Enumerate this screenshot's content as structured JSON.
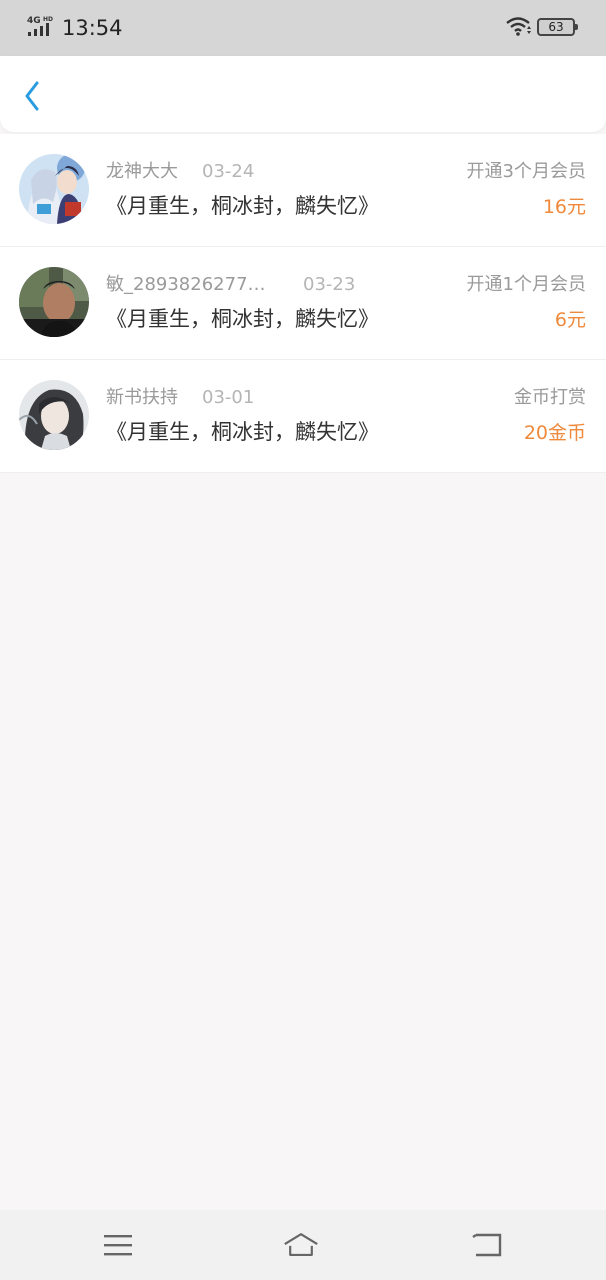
{
  "status_bar": {
    "network": "4G HD",
    "time": "13:54",
    "battery": "63"
  },
  "header": {
    "back_icon": "chevron-left-icon"
  },
  "records": [
    {
      "name": "龙神大大",
      "date": "03-24",
      "book": "《月重生，桐冰封，麟失忆》",
      "type": "开通3个月会员",
      "amount": "16元"
    },
    {
      "name": "敏_2893826277…",
      "date": "03-23",
      "book": "《月重生，桐冰封，麟失忆》",
      "type": "开通1个月会员",
      "amount": "6元"
    },
    {
      "name": "新书扶持",
      "date": "03-01",
      "book": "《月重生，桐冰封，麟失忆》",
      "type": "金币打赏",
      "amount": "20金币"
    }
  ],
  "nav": {
    "menu_icon": "menu-icon",
    "home_icon": "home-icon",
    "back_icon": "back-icon"
  },
  "colors": {
    "accent": "#2a9be0",
    "amount": "#ef8a3d"
  }
}
